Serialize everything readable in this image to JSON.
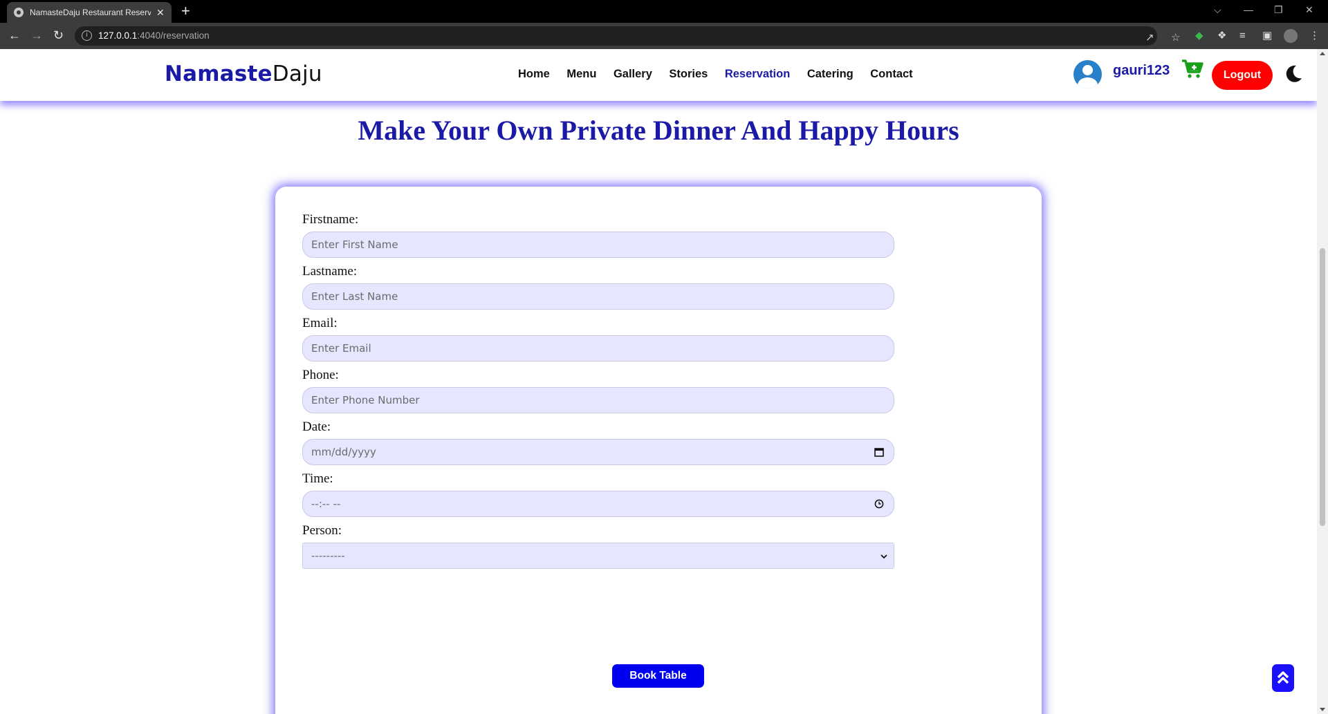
{
  "browser": {
    "tab_title": "NamasteDaju Restaurant Reserva",
    "tab_close": "✕",
    "new_tab": "+",
    "url_host": "127.0.0.1",
    "url_path": ":4040/reservation",
    "window_controls": [
      "⌵",
      "—",
      "❐",
      "✕"
    ]
  },
  "header": {
    "logo_part1": "Namaste",
    "logo_part2": "Daju",
    "nav": [
      "Home",
      "Menu",
      "Gallery",
      "Stories",
      "Reservation",
      "Catering",
      "Contact"
    ],
    "active_nav": "Reservation",
    "username": "gauri123",
    "logout_label": "Logout",
    "brand_color": "#1a1aa6",
    "logout_color": "#ff0000",
    "cart_color": "#18a018"
  },
  "main": {
    "title": "Make Your Own Private Dinner And Happy Hours",
    "form": {
      "firstname_label": "Firstname:",
      "firstname_placeholder": "Enter First Name",
      "lastname_label": "Lastname:",
      "lastname_placeholder": "Enter Last Name",
      "email_label": "Email:",
      "email_placeholder": "Enter Email",
      "phone_label": "Phone:",
      "phone_placeholder": "Enter Phone Number",
      "date_label": "Date:",
      "date_value": "mm/dd/yyyy",
      "time_label": "Time:",
      "time_value": "--:-- --",
      "person_label": "Person:",
      "person_selected": "---------",
      "submit_label": "Book Table"
    }
  }
}
